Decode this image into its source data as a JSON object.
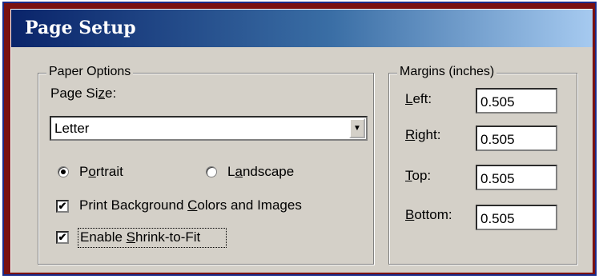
{
  "dialog": {
    "title": "Page Setup"
  },
  "paper_options": {
    "legend": "Paper Options",
    "page_size_label_pre": "Page Si",
    "page_size_label_u": "z",
    "page_size_label_post": "e:",
    "page_size_value": "Letter",
    "portrait_pre": "P",
    "portrait_u": "o",
    "portrait_post": "rtrait",
    "landscape_pre": "L",
    "landscape_u": "a",
    "landscape_post": "ndscape",
    "orientation_selected": "Portrait",
    "print_bg_pre": "Print Background ",
    "print_bg_u": "C",
    "print_bg_post": "olors and Images",
    "print_bg_checked": true,
    "shrink_pre": "Enable ",
    "shrink_u": "S",
    "shrink_post": "hrink-to-Fit",
    "shrink_checked": true
  },
  "margins": {
    "legend": "Margins (inches)",
    "left_u": "L",
    "left_post": "eft:",
    "left_value": "0.505",
    "right_u": "R",
    "right_post": "ight:",
    "right_value": "0.505",
    "top_u": "T",
    "top_post": "op:",
    "top_value": "0.505",
    "bottom_u": "B",
    "bottom_post": "ottom:",
    "bottom_value": "0.505"
  },
  "check_glyph": "✔"
}
